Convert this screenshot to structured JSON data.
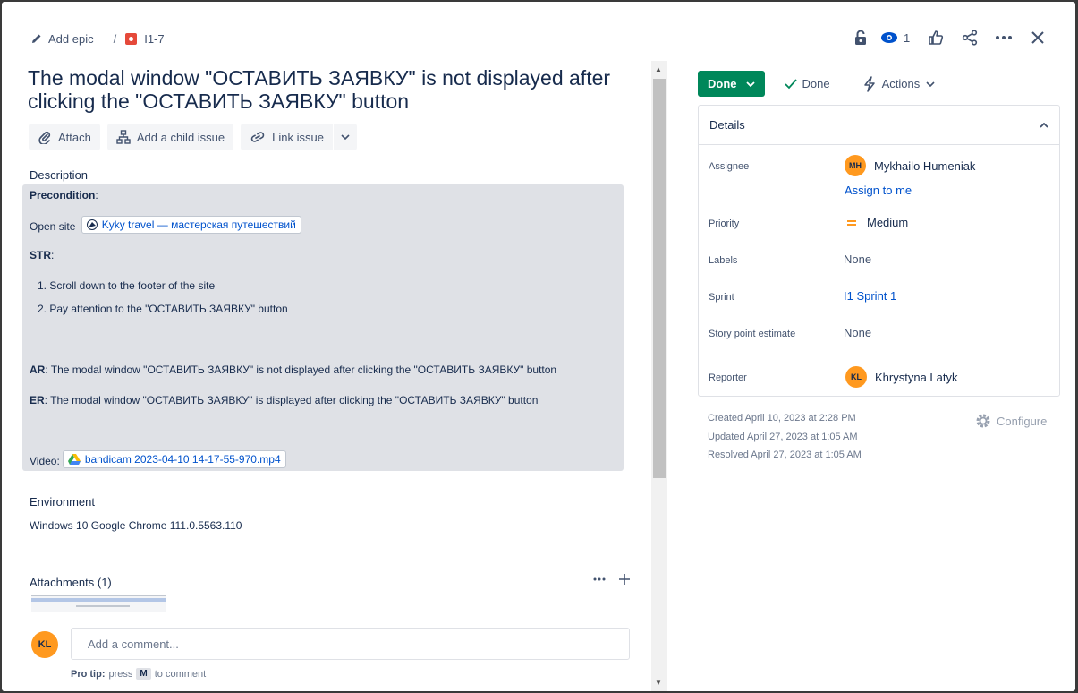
{
  "breadcrumb": {
    "add_epic": "Add epic",
    "separator": "/",
    "issue_key": "I1-7"
  },
  "header": {
    "watch_count": "1"
  },
  "issue": {
    "title": "The modal window \"ОСТАВИТЬ ЗАЯВКУ\" is not displayed after clicking the \"ОСТАВИТЬ ЗАЯВКУ\" button"
  },
  "toolbar": {
    "attach": "Attach",
    "add_child": "Add a child issue",
    "link_issue": "Link issue"
  },
  "description": {
    "label": "Description",
    "precondition_label": "Precondition",
    "precondition_suffix": ":",
    "open_site": "Open site",
    "site_link": "Kyky travel — мастерская путешествий",
    "str_label": "STR",
    "str_suffix": ":",
    "steps": [
      "1. Scroll down to the footer of the site",
      "2. Pay attention to the \"ОСТАВИТЬ ЗАЯВКУ\" button"
    ],
    "ar_label": "AR",
    "ar_text": ": The modal window \"ОСТАВИТЬ ЗАЯВКУ\" is not displayed after clicking the \"ОСТАВИТЬ ЗАЯВКУ\"  button",
    "er_label": "ER",
    "er_text": ": The modal window \"ОСТАВИТЬ ЗАЯВКУ\" is displayed after clicking the \"ОСТАВИТЬ ЗАЯВКУ\"  button",
    "video_label": "Video:",
    "video_link": "bandicam 2023-04-10 14-17-55-970.mp4"
  },
  "environment": {
    "label": "Environment",
    "value": "Windows 10  Google Chrome 111.0.5563.110"
  },
  "attachments": {
    "label": "Attachments (1)"
  },
  "comment": {
    "avatar": "KL",
    "placeholder": "Add a comment...",
    "protip_bold": "Pro tip:",
    "protip_press": "press",
    "protip_key": "M",
    "protip_rest": "to comment"
  },
  "status": {
    "button": "Done",
    "resolution": "Done",
    "actions": "Actions"
  },
  "details": {
    "header": "Details",
    "assignee_label": "Assignee",
    "assignee_initials": "MH",
    "assignee_name": "Mykhailo Humeniak",
    "assign_to_me": "Assign to me",
    "priority_label": "Priority",
    "priority_value": "Medium",
    "labels_label": "Labels",
    "labels_value": "None",
    "sprint_label": "Sprint",
    "sprint_value": "I1 Sprint 1",
    "story_label": "Story point estimate",
    "story_value": "None",
    "reporter_label": "Reporter",
    "reporter_initials": "KL",
    "reporter_name": "Khrystyna Latyk"
  },
  "meta": {
    "created": "Created April 10, 2023 at 2:28 PM",
    "updated": "Updated April 27, 2023 at 1:05 AM",
    "resolved": "Resolved April 27, 2023 at 1:05 AM",
    "configure": "Configure"
  },
  "colors": {
    "done_green": "#00875a",
    "link_blue": "#0052cc",
    "bug_red": "#e5493a",
    "avatar_orange": "#ff991f",
    "priority_orange": "#ff991f"
  }
}
